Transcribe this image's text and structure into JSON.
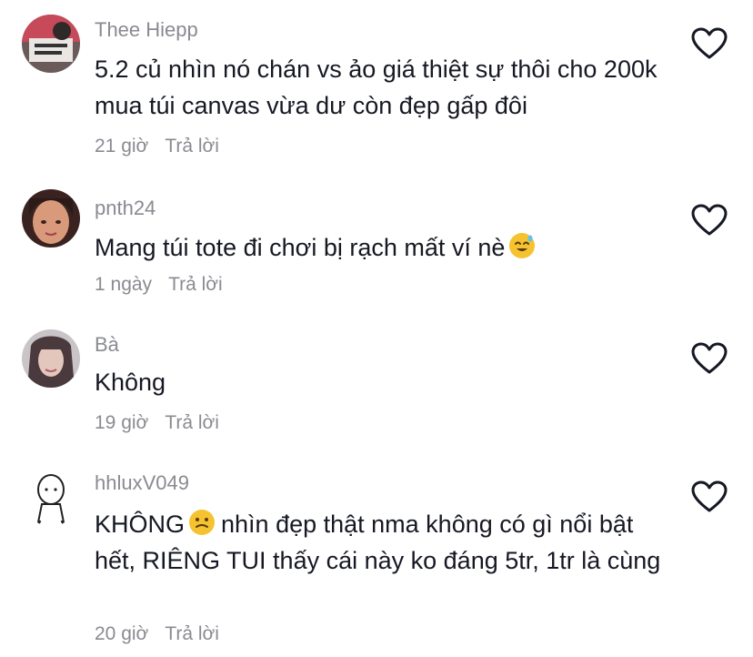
{
  "comments": [
    {
      "username": "Thee Hiepp",
      "text": "5.2 củ nhìn nó chán vs ảo giá thiệt sự thôi cho 200k mua túi canvas vừa dư còn đẹp gấp đôi",
      "time": "21 giờ",
      "reply": "Trả lời",
      "emoji": ""
    },
    {
      "username": "pnth24",
      "text": "Mang túi tote đi chơi bị rạch mất ví nè",
      "time": "1 ngày",
      "reply": "Trả lời",
      "emoji": "sweat-smile-emoji"
    },
    {
      "username": "Bà",
      "text": "Không",
      "time": "19 giờ",
      "reply": "Trả lời",
      "emoji": ""
    },
    {
      "username": "hhluxV049",
      "text_before_emoji": "KHÔNG",
      "text": "nhìn đẹp thật nma không có gì nổi bật hết, RIÊNG TUI thấy cái này ko đáng 5tr, 1tr là cùng",
      "time": "20 giờ",
      "reply": "Trả lời",
      "emoji": "grimace-emoji"
    }
  ],
  "icons": {
    "like": "heart-outline-icon"
  },
  "colors": {
    "text": "#161823",
    "muted": "#8a8b91",
    "emoji": "#f5c230"
  }
}
